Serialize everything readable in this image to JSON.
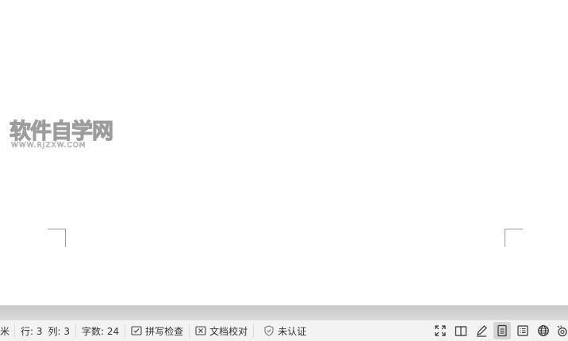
{
  "document": {
    "watermark": {
      "text": "软件自学网",
      "subtext": "WWW.RJZXW.COM"
    }
  },
  "statusbar": {
    "partial_unit": "米",
    "row": "行: 3",
    "column": "列: 3",
    "word_count": "字数: 24",
    "spell_check": "拼写检查",
    "doc_proof": "文档校对",
    "certification": "未认证"
  },
  "view_buttons": {
    "active": "page-view",
    "items": [
      "fullscreen",
      "reading-view",
      "edit-view",
      "page-view",
      "outline-view",
      "web-view",
      "eye-protect"
    ]
  },
  "colors": {
    "statusbar_bg": "#f3f3f3",
    "band": "#cccccc",
    "active_button": "#d4d4d4"
  }
}
